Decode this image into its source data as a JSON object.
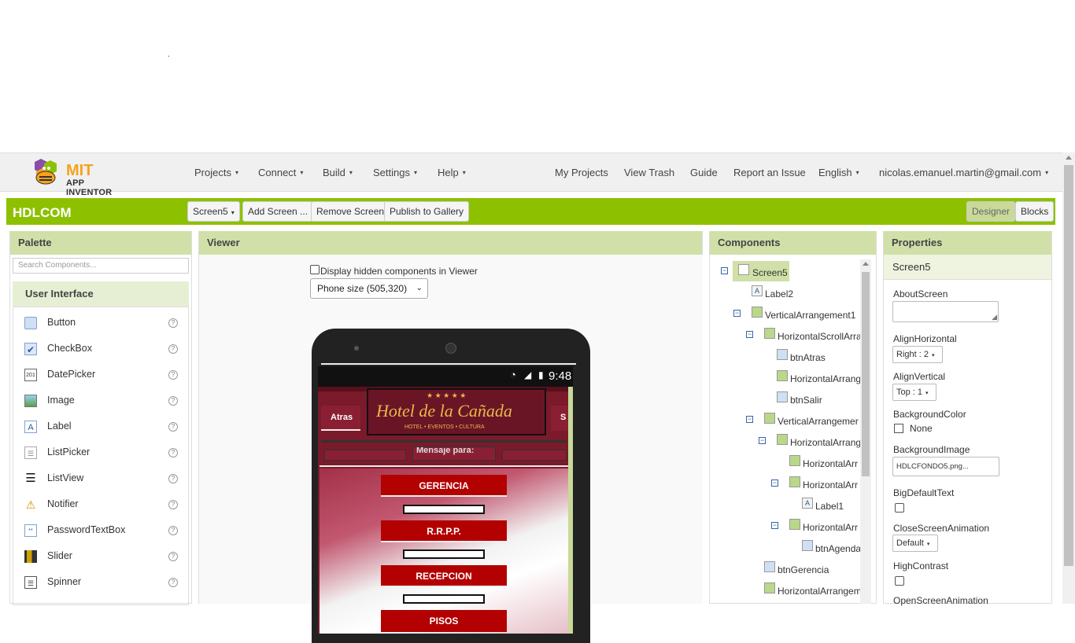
{
  "page": {
    "stray_dot": "."
  },
  "logo": {
    "brand": "MIT",
    "product": "APP INVENTOR"
  },
  "topnav": {
    "left": [
      "Projects",
      "Connect",
      "Build",
      "Settings",
      "Help"
    ],
    "right": [
      "My Projects",
      "View Trash",
      "Guide",
      "Report an Issue",
      "English",
      "nicolas.emanuel.martin@gmail.com"
    ]
  },
  "toolbar": {
    "project": "HDLCOM",
    "screen_select": "Screen5",
    "add_screen": "Add Screen ...",
    "remove_screen": "Remove Screen",
    "publish": "Publish to Gallery",
    "designer": "Designer",
    "blocks": "Blocks"
  },
  "palette": {
    "title": "Palette",
    "search_placeholder": "Search Components...",
    "category": "User Interface",
    "items": [
      {
        "label": "Button",
        "icon": "button-icon"
      },
      {
        "label": "CheckBox",
        "icon": "checkbox-icon"
      },
      {
        "label": "DatePicker",
        "icon": "datepicker-icon"
      },
      {
        "label": "Image",
        "icon": "image-icon"
      },
      {
        "label": "Label",
        "icon": "label-icon"
      },
      {
        "label": "ListPicker",
        "icon": "listpicker-icon"
      },
      {
        "label": "ListView",
        "icon": "listview-icon"
      },
      {
        "label": "Notifier",
        "icon": "notifier-icon"
      },
      {
        "label": "PasswordTextBox",
        "icon": "password-icon"
      },
      {
        "label": "Slider",
        "icon": "slider-icon"
      },
      {
        "label": "Spinner",
        "icon": "spinner-icon"
      }
    ],
    "help_glyph": "?"
  },
  "viewer": {
    "title": "Viewer",
    "hidden_label": "Display hidden components in Viewer",
    "size_select": "Phone size (505,320)",
    "time": "9:48",
    "btn_atras": "Atras",
    "btn_salir_partial": "S",
    "hotel_name": "Hotel de la Cañada",
    "hotel_sub": "HOTEL • EVENTOS • CULTURA",
    "hotel_stars": "★ ★ ★ ★ ★",
    "mensaje": "Mensaje para:",
    "buttons": [
      "GERENCIA",
      "R.R.P.P.",
      "RECEPCION",
      "PISOS"
    ]
  },
  "components": {
    "title": "Components",
    "tree": [
      {
        "label": "Screen5",
        "toggle": "−"
      },
      {
        "label": "Label2",
        "toggle": ""
      },
      {
        "label": "VerticalArrangement1",
        "toggle": "−"
      },
      {
        "label": "HorizontalScrollArra",
        "toggle": "−"
      },
      {
        "label": "btnAtras",
        "toggle": ""
      },
      {
        "label": "HorizontalArrang",
        "toggle": ""
      },
      {
        "label": "btnSalir",
        "toggle": ""
      },
      {
        "label": "VerticalArrangemer",
        "toggle": "−"
      },
      {
        "label": "HorizontalArrang",
        "toggle": "−"
      },
      {
        "label": "HorizontalArr",
        "toggle": ""
      },
      {
        "label": "HorizontalArr",
        "toggle": "−"
      },
      {
        "label": "Label1",
        "toggle": ""
      },
      {
        "label": "HorizontalArr",
        "toggle": "−"
      },
      {
        "label": "btnAgenda",
        "toggle": ""
      },
      {
        "label": "btnGerencia",
        "toggle": ""
      },
      {
        "label": "HorizontalArrangem",
        "toggle": ""
      }
    ]
  },
  "properties": {
    "title": "Properties",
    "screen": "Screen5",
    "about": "AboutScreen",
    "align_h": "AlignHorizontal",
    "align_h_val": "Right : 2",
    "align_v": "AlignVertical",
    "align_v_val": "Top : 1",
    "bg_color": "BackgroundColor",
    "bg_color_val": "None",
    "bg_image": "BackgroundImage",
    "bg_image_val": "HDLCFONDO5.png...",
    "big_text": "BigDefaultText",
    "close_anim": "CloseScreenAnimation",
    "close_anim_val": "Default",
    "high_contrast": "HighContrast",
    "open_anim": "OpenScreenAnimation"
  },
  "colors": {
    "green_bar": "#8dc100",
    "panel_header": "#d0e0a8",
    "app_red": "#b30000",
    "app_maroon": "#7a1a2a"
  }
}
